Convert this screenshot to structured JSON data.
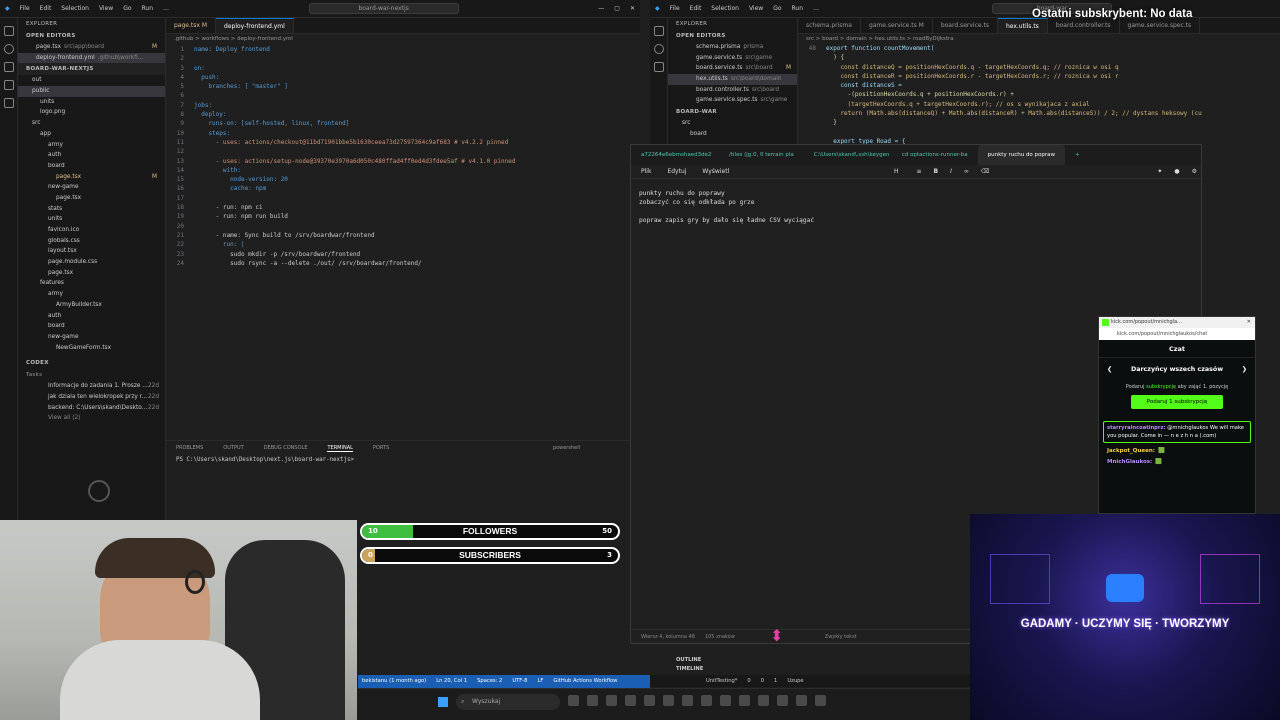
{
  "left_vscode": {
    "menu": [
      "File",
      "Edit",
      "Selection",
      "View",
      "Go",
      "Run",
      "…"
    ],
    "search": "board-war-nextjs",
    "explorer_title": "EXPLORER",
    "open_editors_title": "OPEN EDITORS",
    "open_editors": [
      {
        "name": "page.tsx",
        "path": "src\\app\\board",
        "badge": "M"
      },
      {
        "name": "deploy-frontend.yml",
        "path": ".github\\workfl...",
        "badge": ""
      }
    ],
    "project_title": "BOARD-WAR-NEXTJS",
    "tree": [
      {
        "name": "out",
        "indent": 1
      },
      {
        "name": "public",
        "indent": 1,
        "sel": true
      },
      {
        "name": "units",
        "indent": 2
      },
      {
        "name": "logo.png",
        "indent": 2
      },
      {
        "name": "src",
        "indent": 1
      },
      {
        "name": "app",
        "indent": 2
      },
      {
        "name": "army",
        "indent": 3
      },
      {
        "name": "auth",
        "indent": 3
      },
      {
        "name": "board",
        "indent": 3
      },
      {
        "name": "page.tsx",
        "indent": 4,
        "badge": "M"
      },
      {
        "name": "new-game",
        "indent": 3
      },
      {
        "name": "page.tsx",
        "indent": 4
      },
      {
        "name": "stats",
        "indent": 3
      },
      {
        "name": "units",
        "indent": 3
      },
      {
        "name": "favicon.ico",
        "indent": 3
      },
      {
        "name": "globals.css",
        "indent": 3
      },
      {
        "name": "layout.tsx",
        "indent": 3
      },
      {
        "name": "page.module.css",
        "indent": 3
      },
      {
        "name": "page.tsx",
        "indent": 3
      },
      {
        "name": "features",
        "indent": 2
      },
      {
        "name": "army",
        "indent": 3
      },
      {
        "name": "ArmyBuilder.tsx",
        "indent": 4
      },
      {
        "name": "auth",
        "indent": 3
      },
      {
        "name": "board",
        "indent": 3
      },
      {
        "name": "new-game",
        "indent": 3
      },
      {
        "name": "NewGameForm.tsx",
        "indent": 4
      }
    ],
    "codex_title": "CODEX",
    "tasks_title": "Tasks",
    "tasks": [
      {
        "text": "Informacje do zadania 1. Prosze ...",
        "age": "22d"
      },
      {
        "text": "jak dziala ten wielokropek przy r...",
        "age": "22d"
      },
      {
        "text": "backend: C:\\Users\\skand\\Deskto...",
        "age": "22d"
      }
    ],
    "view_all": "View all (2)",
    "tabs": [
      {
        "label": "page.tsx M",
        "active": false
      },
      {
        "label": "deploy-frontend.yml",
        "active": true
      }
    ],
    "breadcrumb": ".github > workflows > deploy-frontend.yml",
    "code": [
      "name: Deploy frontend",
      "",
      "on:",
      "  push:",
      "    branches: [ \"master\" ]",
      "",
      "jobs:",
      "  deploy:",
      "    runs-on: [self-hosted, linux, frontend]",
      "    steps:",
      "      - uses: actions/checkout@11bd71901bbe5b1630ceea73d27597364c9af683 # v4.2.2 pinned",
      "",
      "      - uses: actions/setup-node@39370e3970a6d050c480ffad4ff0ed4d3fdee5af # v4.1.0 pinned",
      "        with:",
      "          node-version: 20",
      "          cache: npm",
      "",
      "      - run: npm ci",
      "      - run: npm run build",
      "",
      "      - name: Sync build to /srv/boardwar/frontend",
      "        run: |",
      "          sudo mkdir -p /srv/boardwar/frontend",
      "          sudo rsync -a --delete ./out/ /srv/boardwar/frontend/"
    ],
    "panel_tabs": [
      "PROBLEMS",
      "OUTPUT",
      "DEBUG CONSOLE",
      "TERMINAL",
      "PORTS"
    ],
    "terminal_shell": "powershell",
    "terminal_line": "PS C:\\Users\\skand\\Desktop\\next.js\\board-war-nextjs>",
    "status": [
      "bekistanu (1 month ago)",
      "Ln 20, Col 1",
      "Spaces: 2",
      "UTF-8",
      "LF",
      "GitHub Actions Workflow"
    ]
  },
  "right_vscode": {
    "menu": [
      "File",
      "Edit",
      "Selection",
      "View",
      "Go",
      "Run",
      "…"
    ],
    "search": "board-war",
    "overlay_text": "Ostatni subskrybent: No data",
    "open_editors": [
      {
        "name": "schema.prisma",
        "path": "prisma"
      },
      {
        "name": "game.service.ts",
        "path": "src\\game"
      },
      {
        "name": "board.service.ts",
        "path": "src\\board",
        "badge": "M"
      },
      {
        "name": "hex.utils.ts",
        "path": "src\\board\\domain",
        "sel": true
      },
      {
        "name": "board.controller.ts",
        "path": "src\\board"
      },
      {
        "name": "game.service.spec.ts",
        "path": "src\\game"
      }
    ],
    "project_title": "BOARD-WAR",
    "tree": [
      "src",
      "board"
    ],
    "tabs": [
      "schema.prisma",
      "game.service.ts M",
      "board.service.ts",
      "hex.utils.ts",
      "board.controller.ts",
      "game.service.spec.ts"
    ],
    "breadcrumb": "src > board > domain > hex.utils.ts > roadByDijkstra",
    "code": [
      {
        "n": "48",
        "t": "export function countMovement("
      },
      {
        "n": "",
        "t": "  ) {"
      },
      {
        "n": "",
        "t": "    const distanceQ = positionHexCoords.q - targetHexCoords.q; // roznica w osi q"
      },
      {
        "n": "",
        "t": "    const distanceR = positionHexCoords.r - targetHexCoords.r; // roznica w osi r"
      },
      {
        "n": "",
        "t": "    const distanceS ="
      },
      {
        "n": "",
        "t": "      -(positionHexCoords.q + positionHexCoords.r) +"
      },
      {
        "n": "",
        "t": "      (targetHexCoords.q + targetHexCoords.r); // os s wynikajaca z axial"
      },
      {
        "n": "",
        "t": "    return (Math.abs(distanceQ) + Math.abs(distanceR) + Math.abs(distanceS)) / 2; // dystans heksowy (cu"
      },
      {
        "n": "",
        "t": "  }"
      },
      {
        "n": "",
        "t": ""
      },
      {
        "n": "",
        "t": "  export type Road = {"
      }
    ],
    "side_items": [
      "OUTLINE",
      "TIMELINE"
    ],
    "status": [
      "UnitTesting*",
      "0",
      "0",
      "1",
      "Uzupe"
    ]
  },
  "notepad": {
    "tabs": [
      "a72264e6ebmshaed3de2",
      "/tiles (jg.0, 0 terrain pla",
      "C:\\Users\\skand\\.ssh\\keygen",
      "cd optactions-runner-ba",
      "punkty ruchu do popraw"
    ],
    "menu": [
      "Plik",
      "Edytuj",
      "Wyświetl"
    ],
    "heading_label": "H",
    "lines": [
      "punkty ruchu do poprawy",
      "zobaczyć co się odkłada po grze",
      "",
      "popraw zapis gry by dało się ładne CSV wyciągać"
    ],
    "status": [
      "Wiersz 4, kolumna 48",
      "105 znaków",
      "Zwykły tekst"
    ]
  },
  "kick": {
    "window_title": "kick.com/popout/mnichgla...",
    "url": "kick.com/popout/mnichglaukos/chat",
    "chat_title": "Czat",
    "section_title": "Darczyńcy wszech czasów",
    "gift_text_pre": "Podaruj",
    "gift_text_em": "subskrypcję",
    "gift_text_post": "aby zająć 1. pozycję",
    "gift_button": "Podaruj 1 subskrypcję",
    "highlight_user": "starryraincoatinprz:",
    "highlight_text": "@mnichglaukos We will make you popular. Come in — n e z h n a (.com)",
    "messages": [
      {
        "user": "Jackpot_Queen:",
        "text": "🟩"
      },
      {
        "user": "MnichGlaukos:",
        "text": "🟩"
      }
    ],
    "colors": {
      "accent": "#53fc18"
    }
  },
  "overlays": {
    "followers": {
      "label": "FOLLOWERS",
      "current": "10",
      "goal": "50",
      "fill_pct": 20,
      "color": "#3fbf3f"
    },
    "subscribers": {
      "label": "SUBSCRIBERS",
      "current": "0",
      "goal": "3",
      "fill_pct": 5,
      "color": "#c9a55a"
    },
    "banner_text": "GADAMY · UCZYMY SIĘ · TWORZYMY"
  },
  "taskbar": {
    "search_placeholder": "Wyszukaj"
  }
}
